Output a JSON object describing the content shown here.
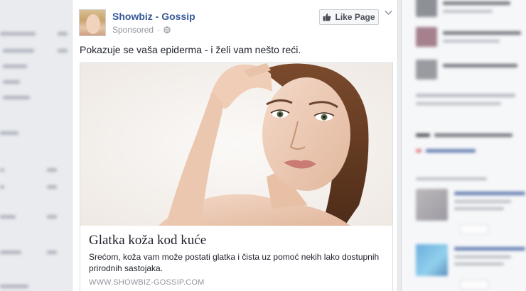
{
  "post": {
    "page_name": "Showbiz - Gossip",
    "sponsored": "Sponsored",
    "separator": "·",
    "like_button": "Like Page",
    "text": "Pokazuje se vaša epiderma - i želi vam nešto reći.",
    "link": {
      "headline": "Glatka koža kod kuće",
      "description": "Srećom, koža vam može postati glatka i čista uz pomoć nekih lako dostupnih prirodnih sastojaka.",
      "domain": "WWW.SHOWBIZ-GOSSIP.COM"
    }
  },
  "icons": {
    "privacy": "globe-icon",
    "like": "thumbs-up-icon",
    "menu": "chevron-down-icon"
  },
  "colors": {
    "page_background": "#e9ebee",
    "link_blue": "#365899",
    "meta_gray": "#90949c",
    "card_background": "#ffffff"
  }
}
